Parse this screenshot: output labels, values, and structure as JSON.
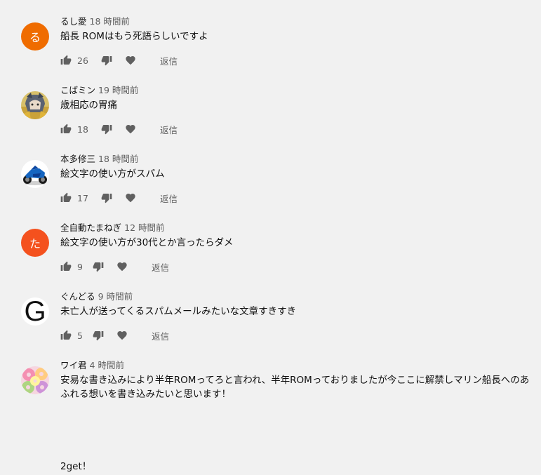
{
  "comments": [
    {
      "author": "るし愛",
      "time": "18 時間前",
      "text": "船長 ROMはもう死語らしいですよ",
      "likes": "26",
      "reply": "返信",
      "avatar": {
        "type": "letter",
        "letter": "る",
        "color": "#ef6c00"
      }
    },
    {
      "author": "こばミン",
      "time": "19 時間前",
      "text": "歳相応の胃痛",
      "likes": "18",
      "reply": "返信",
      "avatar": {
        "type": "image",
        "desc": "anime-character-avatar"
      }
    },
    {
      "author": "本多修三",
      "time": "18 時間前",
      "text": "絵文字の使い方がスパム",
      "likes": "17",
      "reply": "返信",
      "avatar": {
        "type": "image",
        "desc": "blue-motorcycle-avatar"
      }
    },
    {
      "author": "全自動たまねぎ",
      "time": "12 時間前",
      "text": "絵文字の使い方が30代とか言ったらダメ",
      "likes": "9",
      "reply": "返信",
      "avatar": {
        "type": "letter",
        "letter": "た",
        "color": "#f4511e"
      }
    },
    {
      "author": "ぐんどる",
      "time": "9 時間前",
      "text": "未亡人が送ってくるスパムメールみたいな文章すきすき",
      "likes": "5",
      "reply": "返信",
      "avatar": {
        "type": "letter-white",
        "letter": "G",
        "color": "#ffffff"
      }
    },
    {
      "author": "ワイ君",
      "time": "4 時間前",
      "text": "安易な書き込みにより半年ROMってろと言われ、半年ROMっておりましたが今ここに解禁しマリン船長へのあふれる想いを書き込みたいと思います！",
      "extra": "2get！",
      "avatar": {
        "type": "image",
        "desc": "donuts-avatar"
      }
    }
  ],
  "icons": {
    "like": "thumb-up-icon",
    "dislike": "thumb-down-icon",
    "heart": "heart-icon"
  }
}
